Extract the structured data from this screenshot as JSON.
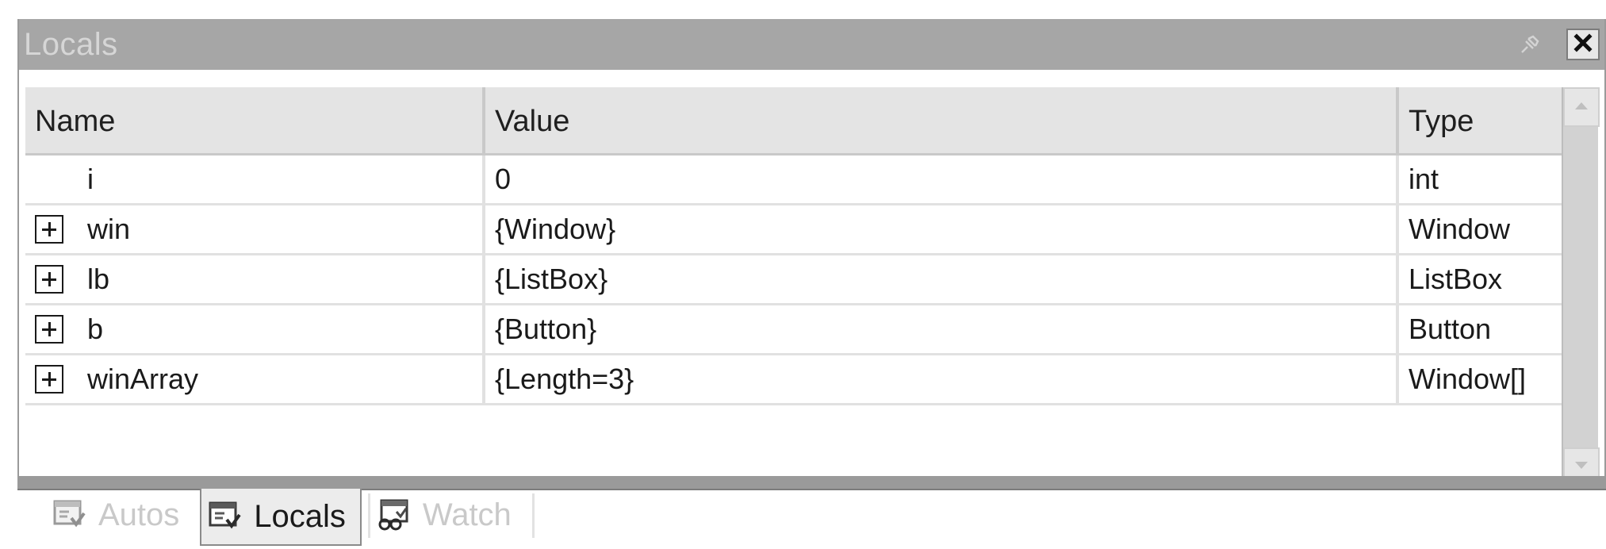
{
  "window": {
    "title": "Locals",
    "pin_icon": "pin-icon",
    "close_icon": "close-icon",
    "close_label": "✖"
  },
  "columns": {
    "name": "Name",
    "value": "Value",
    "type": "Type"
  },
  "rows": [
    {
      "name": "i",
      "value": "0",
      "type": "int",
      "expandable": false
    },
    {
      "name": "win",
      "value": "{Window}",
      "type": "Window",
      "expandable": true
    },
    {
      "name": "lb",
      "value": "{ListBox}",
      "type": "ListBox",
      "expandable": true
    },
    {
      "name": "b",
      "value": "{Button}",
      "type": "Button",
      "expandable": true
    },
    {
      "name": "winArray",
      "value": "{Length=3}",
      "type": "Window[]",
      "expandable": true
    }
  ],
  "tabs": [
    {
      "label": "Autos",
      "icon": "autos-window-icon",
      "active": false
    },
    {
      "label": "Locals",
      "icon": "locals-window-icon",
      "active": true
    },
    {
      "label": "Watch",
      "icon": "watch-window-icon",
      "active": false
    }
  ],
  "colors": {
    "titlebar": "#a6a6a6",
    "title_text": "#d6d6d6",
    "header_bg": "#e4e4e4",
    "inactive_tab_text": "#c9c9c9"
  }
}
